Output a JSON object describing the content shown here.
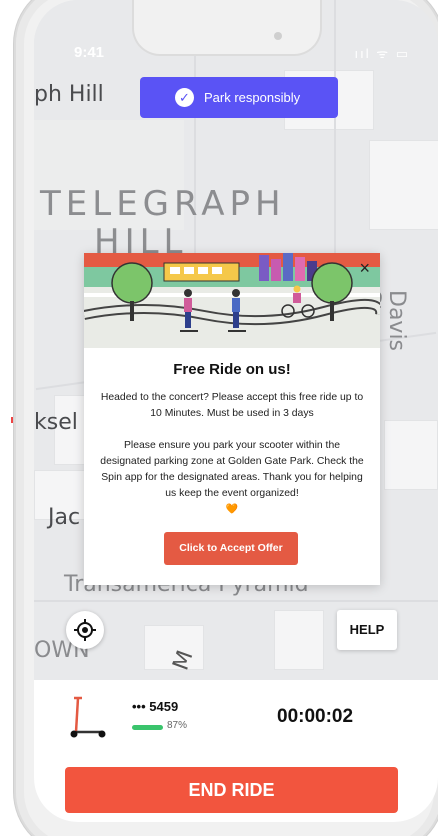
{
  "status_bar": {
    "time": "9:41",
    "icons": "ııl ᯤ ▭"
  },
  "map": {
    "labels": {
      "ph_hill": "ph Hill",
      "telegraph": "TELEGRAPH",
      "hill": "HILL",
      "davis": "Davis St",
      "ksel": "ksel",
      "jac": "Jac",
      "transamerica": "Transamerica Pyramid",
      "own": "OWN",
      "m": "M"
    }
  },
  "park_banner": {
    "label": "Park responsibly",
    "icon": "check-icon"
  },
  "modal": {
    "title": "Free Ride on us!",
    "paragraph1": "Headed to the concert? Please accept this free ride up to 10 Minutes. Must be used in 3 days",
    "paragraph2": "Please ensure you park your scooter within the designated parking zone at Golden Gate Park. Check the Spin app for the designated areas. Thank you for helping us keep the event organized!",
    "heart": "🧡",
    "close": "×",
    "accept_button": "Click to Accept Offer"
  },
  "controls": {
    "help_label": "HELP",
    "locate_icon": "crosshair-icon"
  },
  "ride": {
    "scooter_id": "••• 5459",
    "battery_percent": "87%",
    "battery_level": 0.87,
    "timer": "00:00:02",
    "end_button": "END RIDE"
  },
  "colors": {
    "banner": "#5a53f5",
    "accept": "#e45a43",
    "end_ride": "#f2553e",
    "battery": "#3ac46c"
  }
}
